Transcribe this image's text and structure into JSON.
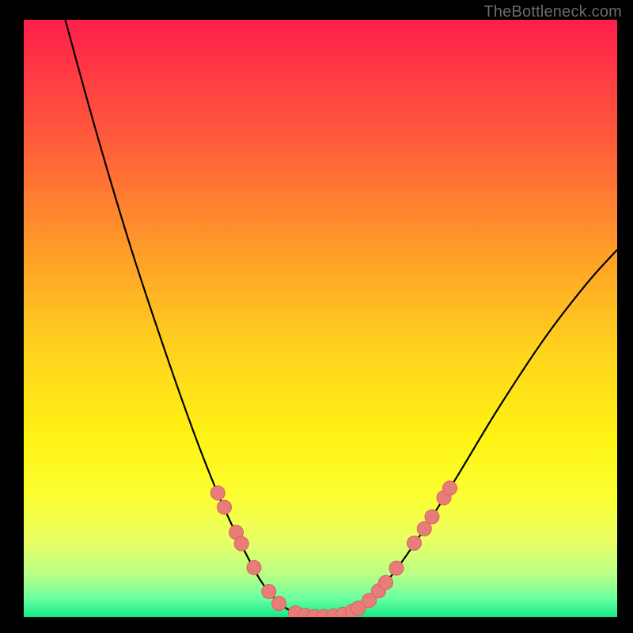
{
  "watermark": "TheBottleneck.com",
  "colors": {
    "black": "#000000",
    "curve": "#000000",
    "dot_fill": "#e77c79",
    "dot_stroke": "#d56461"
  },
  "chart_data": {
    "type": "line",
    "title": "",
    "xlabel": "",
    "ylabel": "",
    "xlim": [
      0,
      100
    ],
    "ylim": [
      0,
      100
    ],
    "background_gradient_stops": [
      {
        "offset": 0.0,
        "color": "#ff1f4b"
      },
      {
        "offset": 0.2,
        "color": "#ff5b3b"
      },
      {
        "offset": 0.4,
        "color": "#ffa128"
      },
      {
        "offset": 0.55,
        "color": "#ffd21e"
      },
      {
        "offset": 0.7,
        "color": "#fff313"
      },
      {
        "offset": 0.8,
        "color": "#fbff33"
      },
      {
        "offset": 0.87,
        "color": "#eaff63"
      },
      {
        "offset": 0.93,
        "color": "#b8ff87"
      },
      {
        "offset": 0.97,
        "color": "#66ffa0"
      },
      {
        "offset": 1.0,
        "color": "#17e884"
      }
    ],
    "curve": {
      "left": [
        {
          "x": 7.0,
          "y": 100.0
        },
        {
          "x": 12.0,
          "y": 82.0
        },
        {
          "x": 18.0,
          "y": 62.0
        },
        {
          "x": 24.0,
          "y": 44.0
        },
        {
          "x": 29.0,
          "y": 30.0
        },
        {
          "x": 33.0,
          "y": 20.0
        },
        {
          "x": 37.0,
          "y": 11.5
        },
        {
          "x": 40.0,
          "y": 6.0
        },
        {
          "x": 43.0,
          "y": 2.4
        },
        {
          "x": 46.0,
          "y": 0.6
        }
      ],
      "trough": [
        {
          "x": 46.0,
          "y": 0.6
        },
        {
          "x": 49.0,
          "y": 0.0
        },
        {
          "x": 52.0,
          "y": 0.0
        },
        {
          "x": 55.0,
          "y": 0.6
        }
      ],
      "right": [
        {
          "x": 55.0,
          "y": 0.6
        },
        {
          "x": 58.0,
          "y": 2.6
        },
        {
          "x": 62.0,
          "y": 7.0
        },
        {
          "x": 67.0,
          "y": 14.0
        },
        {
          "x": 73.0,
          "y": 23.5
        },
        {
          "x": 80.0,
          "y": 35.0
        },
        {
          "x": 88.0,
          "y": 47.0
        },
        {
          "x": 95.0,
          "y": 56.0
        },
        {
          "x": 100.0,
          "y": 61.5
        }
      ]
    },
    "dots": [
      {
        "x": 32.7,
        "y": 20.8
      },
      {
        "x": 33.8,
        "y": 18.4
      },
      {
        "x": 35.8,
        "y": 14.2
      },
      {
        "x": 36.7,
        "y": 12.3
      },
      {
        "x": 38.8,
        "y": 8.3
      },
      {
        "x": 41.3,
        "y": 4.3
      },
      {
        "x": 43.0,
        "y": 2.3
      },
      {
        "x": 45.8,
        "y": 0.7
      },
      {
        "x": 47.4,
        "y": 0.3
      },
      {
        "x": 49.0,
        "y": 0.1
      },
      {
        "x": 50.6,
        "y": 0.1
      },
      {
        "x": 52.2,
        "y": 0.2
      },
      {
        "x": 53.8,
        "y": 0.5
      },
      {
        "x": 55.4,
        "y": 1.0
      },
      {
        "x": 56.4,
        "y": 1.5
      },
      {
        "x": 58.2,
        "y": 2.8
      },
      {
        "x": 59.8,
        "y": 4.4
      },
      {
        "x": 61.0,
        "y": 5.8
      },
      {
        "x": 62.8,
        "y": 8.2
      },
      {
        "x": 65.8,
        "y": 12.4
      },
      {
        "x": 67.5,
        "y": 14.8
      },
      {
        "x": 68.8,
        "y": 16.8
      },
      {
        "x": 70.8,
        "y": 20.0
      },
      {
        "x": 71.8,
        "y": 21.6
      }
    ],
    "dot_radius_px": 9
  }
}
